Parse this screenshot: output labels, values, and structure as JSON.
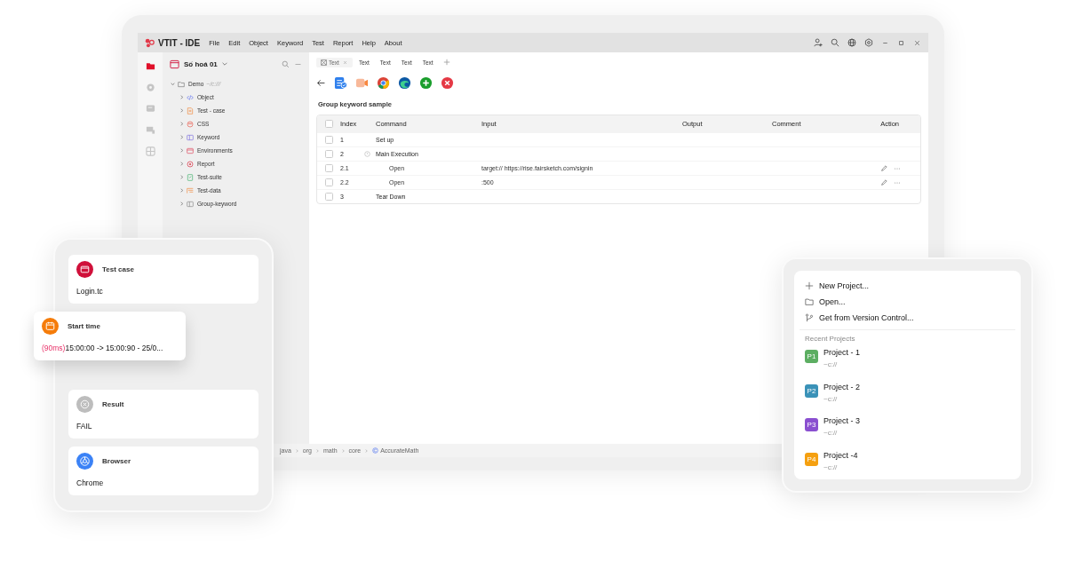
{
  "window": {
    "app_name": "VTIT - IDE",
    "menu": [
      "File",
      "Edit",
      "Object",
      "Keyword",
      "Test",
      "Report",
      "Help",
      "About"
    ]
  },
  "activity_bar": [
    {
      "kind": "files",
      "selected": true
    },
    {
      "kind": "settings",
      "selected": false
    },
    {
      "kind": "chat",
      "selected": false
    },
    {
      "kind": "devices",
      "selected": false
    },
    {
      "kind": "grid",
      "selected": false
    }
  ],
  "sidebar": {
    "project": "Số hoá 01",
    "tree": [
      {
        "label": "Demo",
        "path": "~/c:///",
        "expanded": true,
        "children": [
          {
            "label": "Object",
            "kind": "code",
            "expanded": false
          },
          {
            "label": "Test - case",
            "kind": "testcase",
            "expanded": false
          },
          {
            "label": "CSS",
            "kind": "css",
            "expanded": false
          },
          {
            "label": "Keyword",
            "kind": "keyword",
            "expanded": false
          },
          {
            "label": "Environments",
            "kind": "environments",
            "expanded": false
          },
          {
            "label": "Report",
            "kind": "report",
            "expanded": false
          },
          {
            "label": "Test-suite",
            "kind": "suite",
            "expanded": false
          },
          {
            "label": "Test-data",
            "kind": "data",
            "expanded": false
          },
          {
            "label": "Group-keyword",
            "kind": "group",
            "expanded": false
          }
        ]
      }
    ]
  },
  "tabs": [
    {
      "label": "Text",
      "selected": true
    },
    {
      "label": "Text",
      "selected": false
    },
    {
      "label": "Text",
      "selected": false
    },
    {
      "label": "Text",
      "selected": false
    },
    {
      "label": "Text",
      "selected": false
    }
  ],
  "editor": {
    "title": "Group keyword sample",
    "table": {
      "header_checked": false,
      "columns": [
        "Index",
        "Command",
        "Input",
        "Output",
        "Comment",
        "Action"
      ],
      "rows": [
        {
          "index": "1",
          "command": "Set up",
          "checked": false,
          "actions": false
        },
        {
          "index": "2",
          "command": "Main Execution",
          "checked": false,
          "actions": false,
          "children": [
            {
              "index": "2.1",
              "command": "Open",
              "input": "target:// https://rise.fairsketch.com/signin",
              "checked": false,
              "actions": true
            },
            {
              "index": "2.2",
              "command": "Open",
              "input": ":500",
              "checked": false,
              "actions": true
            }
          ]
        },
        {
          "index": "3",
          "command": "Tear Down",
          "checked": false,
          "actions": false
        }
      ]
    }
  },
  "status_bar": {
    "breadcrumb": [
      "java",
      "org",
      "math",
      "core",
      "AccurateMath"
    ]
  },
  "run_card": {
    "items": [
      {
        "kind": "testcase",
        "label": "Test case",
        "value": "Login.tc"
      },
      {
        "kind": "start_time",
        "label": "Start time",
        "duration": "(90ms)",
        "value": "15:00:00  -> 15:00:90 - 25/0..."
      },
      {
        "kind": "result",
        "label": "Result",
        "value": "FAIL"
      },
      {
        "kind": "browser",
        "label": "Browser",
        "value": "Chrome"
      }
    ]
  },
  "project_menu": {
    "actions": [
      {
        "kind": "new",
        "label": "New Project..."
      },
      {
        "kind": "open",
        "label": "Open..."
      },
      {
        "kind": "vcs",
        "label": "Get from Version Control..."
      }
    ],
    "recent_title": "Recent Projects",
    "recent": [
      {
        "badge": "P1",
        "name": "Project - 1",
        "path": "~c://",
        "color": "#5cae62"
      },
      {
        "badge": "P2",
        "name": "Project - 2",
        "path": "~c://",
        "color": "#3a92b8"
      },
      {
        "badge": "P3",
        "name": "Project - 3",
        "path": "~c://",
        "color": "#8a4fd0"
      },
      {
        "badge": "P4",
        "name": "Project -4",
        "path": "~c://",
        "color": "#f5a010"
      }
    ]
  }
}
